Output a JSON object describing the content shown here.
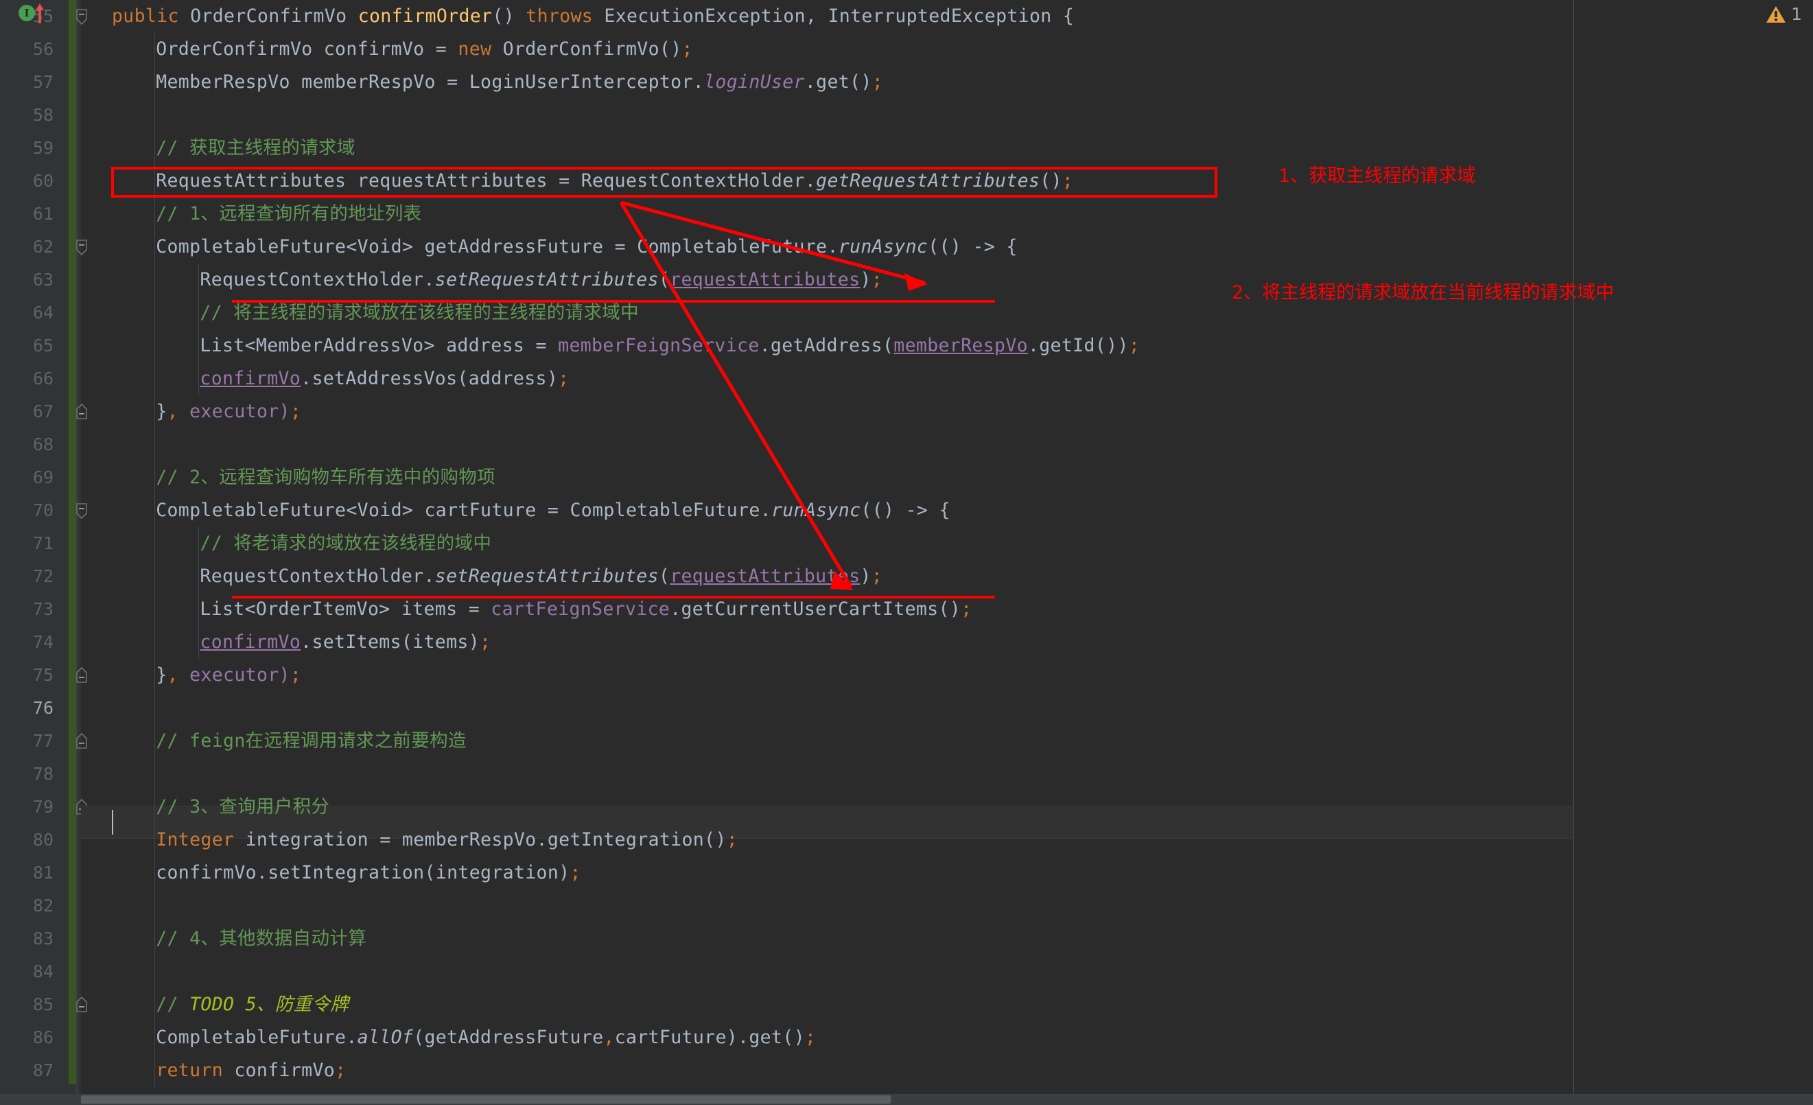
{
  "editor": {
    "theme": "darcula",
    "background": "#2b2b2b",
    "gutter_background": "#313335",
    "current_line": 76,
    "first_line": 55,
    "last_line": 87,
    "vcs_marker_color": "#375623",
    "caret_color": "#bbbbbb"
  },
  "status": {
    "warning_icon": "warning-triangle-icon",
    "warning_count": "1",
    "warning_color": "#e8a33d"
  },
  "gutter": {
    "implementation_marker": "I",
    "implementation_marker_name": "interface-implementation-icon",
    "override_arrow_name": "override-up-arrow-icon",
    "fold_lines": [
      55,
      62,
      67,
      70,
      75,
      77,
      79,
      85
    ],
    "line_numbers": [
      55,
      56,
      57,
      58,
      59,
      60,
      61,
      62,
      63,
      64,
      65,
      66,
      67,
      68,
      69,
      70,
      71,
      72,
      73,
      74,
      75,
      76,
      77,
      78,
      79,
      80,
      81,
      82,
      83,
      84,
      85,
      86,
      87
    ]
  },
  "annotations": {
    "note_1": "1、获取主线程的请求域",
    "note_2": "2、将主线程的请求域放在当前线程的请求域中",
    "color": "#ff0000",
    "boxed_line": 60,
    "underlined_lines": [
      63,
      72
    ],
    "arrow_count": 2
  },
  "code": {
    "lines": [
      {
        "n": 55,
        "indent": 0,
        "tokens": [
          {
            "t": "public",
            "c": "kw"
          },
          {
            "t": " OrderConfirmVo ",
            "c": "ty"
          },
          {
            "t": "confirmOrder",
            "c": "mth"
          },
          {
            "t": "() ",
            "c": "pun"
          },
          {
            "t": "throws",
            "c": "kw"
          },
          {
            "t": " ExecutionException, InterruptedException {",
            "c": "ty"
          }
        ]
      },
      {
        "n": 56,
        "indent": 1,
        "tokens": [
          {
            "t": "OrderConfirmVo confirmVo = ",
            "c": "ty"
          },
          {
            "t": "new",
            "c": "kw"
          },
          {
            "t": " OrderConfirmVo()",
            "c": "ty"
          },
          {
            "t": ";",
            "c": "semi"
          }
        ]
      },
      {
        "n": 57,
        "indent": 1,
        "tokens": [
          {
            "t": "MemberRespVo memberRespVo = LoginUserInterceptor.",
            "c": "ty"
          },
          {
            "t": "loginUser",
            "c": "statf"
          },
          {
            "t": ".get()",
            "c": "ty"
          },
          {
            "t": ";",
            "c": "semi"
          }
        ]
      },
      {
        "n": 58,
        "indent": 0,
        "tokens": []
      },
      {
        "n": 59,
        "indent": 1,
        "tokens": [
          {
            "t": "// 获取主线程的请求域",
            "c": "cmt"
          }
        ]
      },
      {
        "n": 60,
        "indent": 1,
        "tokens": [
          {
            "t": "RequestAttributes requestAttributes = RequestContextHolder.",
            "c": "ty"
          },
          {
            "t": "getRequestAttributes",
            "c": "stat"
          },
          {
            "t": "()",
            "c": "ty"
          },
          {
            "t": ";",
            "c": "semi"
          }
        ]
      },
      {
        "n": 61,
        "indent": 1,
        "tokens": [
          {
            "t": "// 1、远程查询所有的地址列表",
            "c": "cmt"
          }
        ]
      },
      {
        "n": 62,
        "indent": 1,
        "tokens": [
          {
            "t": "CompletableFuture<Void> getAddressFuture = CompletableFuture.",
            "c": "ty"
          },
          {
            "t": "runAsync",
            "c": "stat"
          },
          {
            "t": "(() -> {",
            "c": "ty"
          }
        ]
      },
      {
        "n": 63,
        "indent": 2,
        "tokens": [
          {
            "t": "RequestContextHolder.",
            "c": "ty"
          },
          {
            "t": "setRequestAttributes",
            "c": "stat"
          },
          {
            "t": "(",
            "c": "ty"
          },
          {
            "t": "requestAttributes",
            "c": "fldu"
          },
          {
            "t": ")",
            "c": "ty"
          },
          {
            "t": ";",
            "c": "semi"
          }
        ]
      },
      {
        "n": 64,
        "indent": 2,
        "tokens": [
          {
            "t": "// 将主线程的请求域放在该线程的主线程的请求域中",
            "c": "cmt"
          }
        ]
      },
      {
        "n": 65,
        "indent": 2,
        "tokens": [
          {
            "t": "List<MemberAddressVo> address = ",
            "c": "ty"
          },
          {
            "t": "memberFeignService",
            "c": "fld"
          },
          {
            "t": ".getAddress(",
            "c": "ty"
          },
          {
            "t": "memberRespVo",
            "c": "fldu"
          },
          {
            "t": ".getId())",
            "c": "ty"
          },
          {
            "t": ";",
            "c": "semi"
          }
        ]
      },
      {
        "n": 66,
        "indent": 2,
        "tokens": [
          {
            "t": "confirmVo",
            "c": "fldu"
          },
          {
            "t": ".setAddressVos(address)",
            "c": "ty"
          },
          {
            "t": ";",
            "c": "semi"
          }
        ]
      },
      {
        "n": 67,
        "indent": 1,
        "tokens": [
          {
            "t": "}",
            "c": "ty"
          },
          {
            "t": ",",
            "c": "semi"
          },
          {
            "t": " executor)",
            "c": "fld"
          },
          {
            "t": ";",
            "c": "semi"
          }
        ]
      },
      {
        "n": 68,
        "indent": 0,
        "tokens": []
      },
      {
        "n": 69,
        "indent": 1,
        "tokens": [
          {
            "t": "// 2、远程查询购物车所有选中的购物项",
            "c": "cmt"
          }
        ]
      },
      {
        "n": 70,
        "indent": 1,
        "tokens": [
          {
            "t": "CompletableFuture<Void> cartFuture = CompletableFuture.",
            "c": "ty"
          },
          {
            "t": "runAsync",
            "c": "stat"
          },
          {
            "t": "(() -> {",
            "c": "ty"
          }
        ]
      },
      {
        "n": 71,
        "indent": 2,
        "tokens": [
          {
            "t": "// 将老请求的域放在该线程的域中",
            "c": "cmt"
          }
        ]
      },
      {
        "n": 72,
        "indent": 2,
        "tokens": [
          {
            "t": "RequestContextHolder.",
            "c": "ty"
          },
          {
            "t": "setRequestAttributes",
            "c": "stat"
          },
          {
            "t": "(",
            "c": "ty"
          },
          {
            "t": "requestAttributes",
            "c": "fldu"
          },
          {
            "t": ")",
            "c": "ty"
          },
          {
            "t": ";",
            "c": "semi"
          }
        ]
      },
      {
        "n": 73,
        "indent": 2,
        "tokens": [
          {
            "t": "List<OrderItemVo> items = ",
            "c": "ty"
          },
          {
            "t": "cartFeignService",
            "c": "fld"
          },
          {
            "t": ".getCurrentUserCartItems()",
            "c": "ty"
          },
          {
            "t": ";",
            "c": "semi"
          }
        ]
      },
      {
        "n": 74,
        "indent": 2,
        "tokens": [
          {
            "t": "confirmVo",
            "c": "fldu"
          },
          {
            "t": ".setItems(items)",
            "c": "ty"
          },
          {
            "t": ";",
            "c": "semi"
          }
        ]
      },
      {
        "n": 75,
        "indent": 1,
        "tokens": [
          {
            "t": "}",
            "c": "ty"
          },
          {
            "t": ",",
            "c": "semi"
          },
          {
            "t": " executor)",
            "c": "fld"
          },
          {
            "t": ";",
            "c": "semi"
          }
        ]
      },
      {
        "n": 76,
        "indent": 0,
        "tokens": []
      },
      {
        "n": 77,
        "indent": 1,
        "tokens": [
          {
            "t": "// feign在远程调用请求之前要构造",
            "c": "cmt"
          }
        ]
      },
      {
        "n": 78,
        "indent": 0,
        "tokens": []
      },
      {
        "n": 79,
        "indent": 1,
        "tokens": [
          {
            "t": "// 3、查询用户积分",
            "c": "cmt"
          }
        ]
      },
      {
        "n": 80,
        "indent": 1,
        "tokens": [
          {
            "t": "Integer",
            "c": "kw"
          },
          {
            "t": " integration = memberRespVo.getIntegration()",
            "c": "ty"
          },
          {
            "t": ";",
            "c": "semi"
          }
        ]
      },
      {
        "n": 81,
        "indent": 1,
        "tokens": [
          {
            "t": "confirmVo.setIntegration(integration)",
            "c": "ty"
          },
          {
            "t": ";",
            "c": "semi"
          }
        ]
      },
      {
        "n": 82,
        "indent": 0,
        "tokens": []
      },
      {
        "n": 83,
        "indent": 1,
        "tokens": [
          {
            "t": "// 4、其他数据自动计算",
            "c": "cmt"
          }
        ]
      },
      {
        "n": 84,
        "indent": 0,
        "tokens": []
      },
      {
        "n": 85,
        "indent": 1,
        "tokens": [
          {
            "t": "// ",
            "c": "cmt"
          },
          {
            "t": "TODO 5、防重令牌",
            "c": "todo"
          }
        ]
      },
      {
        "n": 86,
        "indent": 1,
        "tokens": [
          {
            "t": "CompletableFuture.",
            "c": "ty"
          },
          {
            "t": "allOf",
            "c": "stat"
          },
          {
            "t": "(getAddressFuture",
            "c": "ty"
          },
          {
            "t": ",",
            "c": "semi"
          },
          {
            "t": "cartFuture).get()",
            "c": "ty"
          },
          {
            "t": ";",
            "c": "semi"
          }
        ]
      },
      {
        "n": 87,
        "indent": 1,
        "tokens": [
          {
            "t": "return",
            "c": "kw"
          },
          {
            "t": " confirmVo",
            "c": "ty"
          },
          {
            "t": ";",
            "c": "semi"
          }
        ]
      }
    ]
  }
}
